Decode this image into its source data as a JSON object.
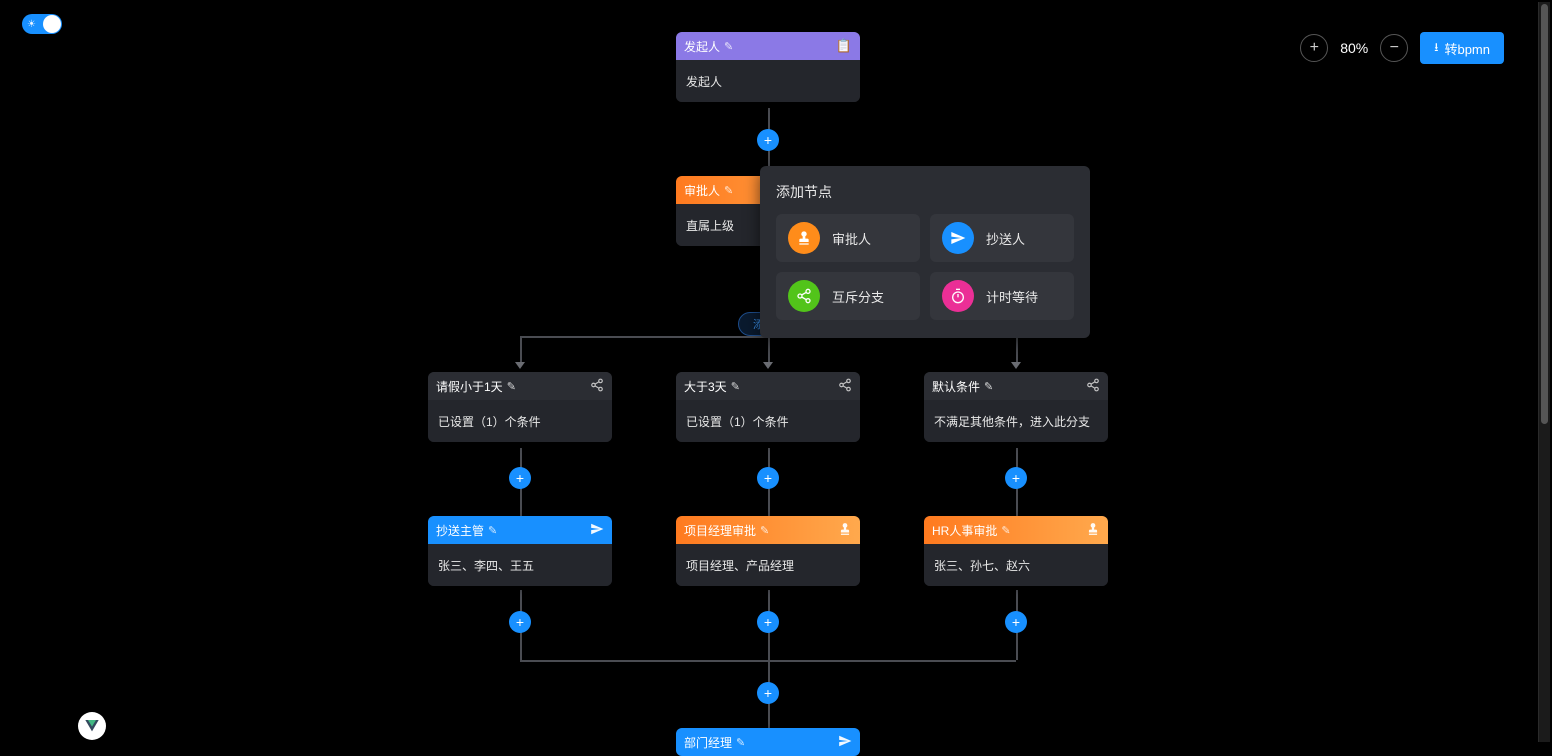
{
  "controls": {
    "zoom": "80%",
    "export_label": "转bpmn"
  },
  "add_branch_label": "添加条件",
  "popover": {
    "title": "添加节点",
    "options": [
      {
        "label": "审批人"
      },
      {
        "label": "抄送人"
      },
      {
        "label": "互斥分支"
      },
      {
        "label": "计时等待"
      }
    ]
  },
  "nodes": {
    "initiator": {
      "title": "发起人",
      "body": "发起人"
    },
    "approver1": {
      "title": "审批人",
      "body": "直属上级"
    },
    "cond1": {
      "title": "请假小于1天",
      "body": "已设置（1）个条件"
    },
    "cond2": {
      "title": "大于3天",
      "body": "已设置（1）个条件"
    },
    "cond3": {
      "title": "默认条件",
      "body": "不满足其他条件，进入此分支"
    },
    "cc": {
      "title": "抄送主管",
      "body": "张三、李四、王五"
    },
    "pm": {
      "title": "项目经理审批",
      "body": "项目经理、产品经理"
    },
    "hr": {
      "title": "HR人事审批",
      "body": "张三、孙七、赵六"
    },
    "dept": {
      "title": "部门经理",
      "body": ""
    }
  }
}
